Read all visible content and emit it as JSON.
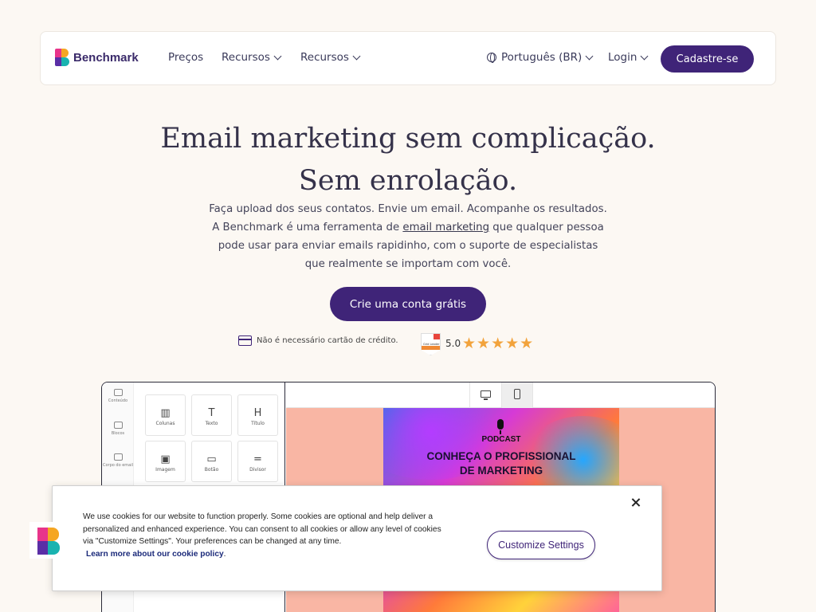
{
  "nav": {
    "brand": "Benchmark",
    "links": [
      "Preços",
      "Recursos",
      "Recursos"
    ],
    "language": "Português (BR)",
    "login": "Login",
    "signup": "Cadastre-se"
  },
  "hero": {
    "title_line1": "Email marketing sem complicação.",
    "title_line2": "Sem enrolação.",
    "text_before": "Faça upload dos seus contatos. Envie um email. Acompanhe os resultados. A Benchmark é uma ferramenta de ",
    "text_link": "email marketing",
    "text_after": " que qualquer pessoa pode usar para enviar emails rapidinho, com o suporte de especialistas que realmente se importam com você.",
    "cta": "Crie uma conta grátis",
    "no_card": "Não é necessário cartão de crédito.",
    "badge_label": "Grid Leader",
    "rating": "5.0",
    "stars": "★★★★★",
    "star_count": 5
  },
  "editor": {
    "rail": [
      "Conteúdo",
      "Blocos",
      "Corpo do email"
    ],
    "blocks": [
      "Colunas",
      "Texto",
      "Título",
      "Imagem",
      "Botão",
      "Divisor"
    ],
    "block_glyphs": [
      "▥",
      "T",
      "H",
      "▣",
      "▭",
      "="
    ],
    "poster_kicker": "PODCAST",
    "poster_line1": "CONHEÇA O PROFISSIONAL",
    "poster_line2": "DE MARKETING"
  },
  "cookie": {
    "text": "We use cookies for our website to function properly. Some cookies are optional and help deliver a personalized and enhanced experience. You can consent to all cookies or allow any level of cookies via \"Customize Settings\". Your preferences can be changed at any time.",
    "link": "Learn more about our cookie policy",
    "link_suffix": ".",
    "customize": "Customize Settings"
  },
  "colors": {
    "brand_purple": "#3f2478",
    "background": "#fcf8f3",
    "star": "#f2a33c",
    "canvas": "#f9b6a4"
  }
}
